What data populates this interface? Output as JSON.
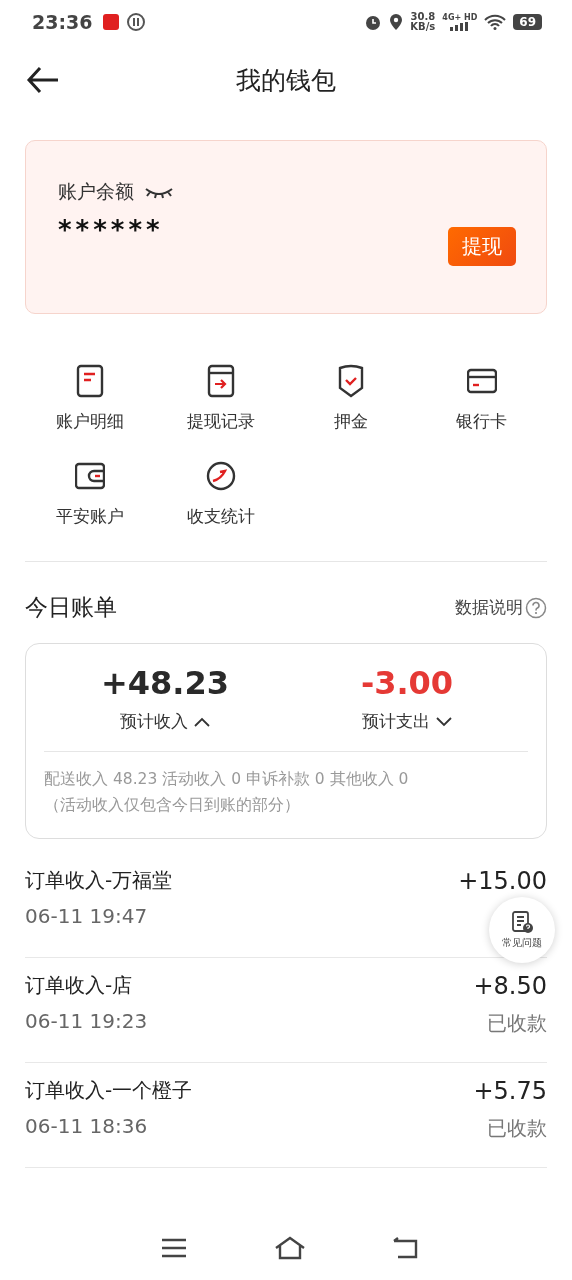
{
  "status_bar": {
    "time": "23:36",
    "speed": "30.8",
    "speed_unit": "KB/s",
    "network": "4G+ HD",
    "battery": "69"
  },
  "header": {
    "title": "我的钱包"
  },
  "balance": {
    "label": "账户余额",
    "value": "******",
    "hidden": true,
    "button": "提现"
  },
  "menu": [
    {
      "label": "账户明细",
      "kind": "doc"
    },
    {
      "label": "提现记录",
      "kind": "withdraw"
    },
    {
      "label": "押金",
      "kind": "shield"
    },
    {
      "label": "银行卡",
      "kind": "card"
    },
    {
      "label": "平安账户",
      "kind": "wallet"
    },
    {
      "label": "收支统计",
      "kind": "chart"
    }
  ],
  "today": {
    "title": "今日账单",
    "help": "数据说明",
    "totals": [
      {
        "amount": "+48.23",
        "label": "预计收入",
        "kind": "income",
        "expanded": true
      },
      {
        "amount": "-3.00",
        "label": "预计支出",
        "kind": "expense",
        "expanded": false
      }
    ],
    "breakdown": "配送收入 48.23 活动收入 0 申诉补款 0 其他收入 0",
    "note": "（活动收入仅包含今日到账的部分）"
  },
  "transactions": [
    {
      "title": "订单收入-万福堂",
      "time": "06-11 19:47",
      "amount": "+15.00"
    },
    {
      "title": "订单收入-店",
      "time": "06-11 19:23",
      "amount": "+8.50",
      "status": "已收款"
    },
    {
      "title": "订单收入-一个橙子",
      "time": "06-11 18:36",
      "amount": "+5.75",
      "status": "已收款"
    }
  ],
  "faq_button": {
    "label": "常见问题"
  }
}
